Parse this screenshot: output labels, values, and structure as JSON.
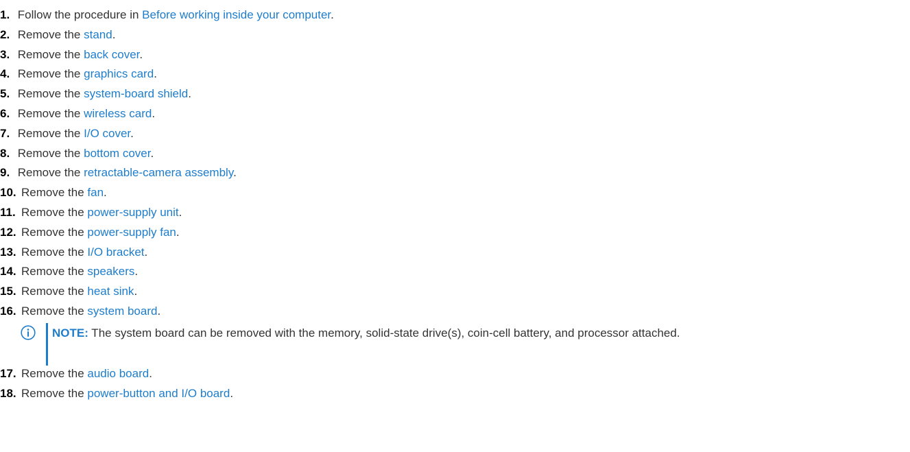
{
  "steps": [
    {
      "num": "1.",
      "pre": "Follow the procedure in ",
      "link": "Before working inside your computer",
      "post": "."
    },
    {
      "num": "2.",
      "pre": "Remove the ",
      "link": "stand",
      "post": "."
    },
    {
      "num": "3.",
      "pre": "Remove the ",
      "link": "back cover",
      "post": "."
    },
    {
      "num": "4.",
      "pre": "Remove the ",
      "link": "graphics card",
      "post": "."
    },
    {
      "num": "5.",
      "pre": "Remove the ",
      "link": "system-board shield",
      "post": "."
    },
    {
      "num": "6.",
      "pre": "Remove the ",
      "link": "wireless card",
      "post": "."
    },
    {
      "num": "7.",
      "pre": "Remove the ",
      "link": "I/O cover",
      "post": "."
    },
    {
      "num": "8.",
      "pre": "Remove the ",
      "link": "bottom cover",
      "post": "."
    },
    {
      "num": "9.",
      "pre": "Remove the ",
      "link": "retractable-camera assembly",
      "post": "."
    },
    {
      "num": "10.",
      "pre": "Remove the ",
      "link": "fan",
      "post": "."
    },
    {
      "num": "11.",
      "pre": "Remove the ",
      "link": "power-supply unit",
      "post": "."
    },
    {
      "num": "12.",
      "pre": "Remove the ",
      "link": "power-supply fan",
      "post": "."
    },
    {
      "num": "13.",
      "pre": "Remove the ",
      "link": "I/O bracket",
      "post": "."
    },
    {
      "num": "14.",
      "pre": "Remove the ",
      "link": "speakers",
      "post": "."
    },
    {
      "num": "15.",
      "pre": "Remove the ",
      "link": "heat sink",
      "post": "."
    },
    {
      "num": "16.",
      "pre": "Remove the ",
      "link": "system board",
      "post": "."
    },
    {
      "num": "17.",
      "pre": "Remove the ",
      "link": "audio board",
      "post": "."
    },
    {
      "num": "18.",
      "pre": "Remove the ",
      "link": "power-button and I/O board",
      "post": "."
    }
  ],
  "note": {
    "icon": "info-icon",
    "label": "NOTE:",
    "text": " The system board can be removed with the memory, solid-state drive(s), coin-cell battery, and processor attached."
  },
  "colors": {
    "link": "#1e7dcb",
    "text": "#333333",
    "number": "#000000"
  }
}
